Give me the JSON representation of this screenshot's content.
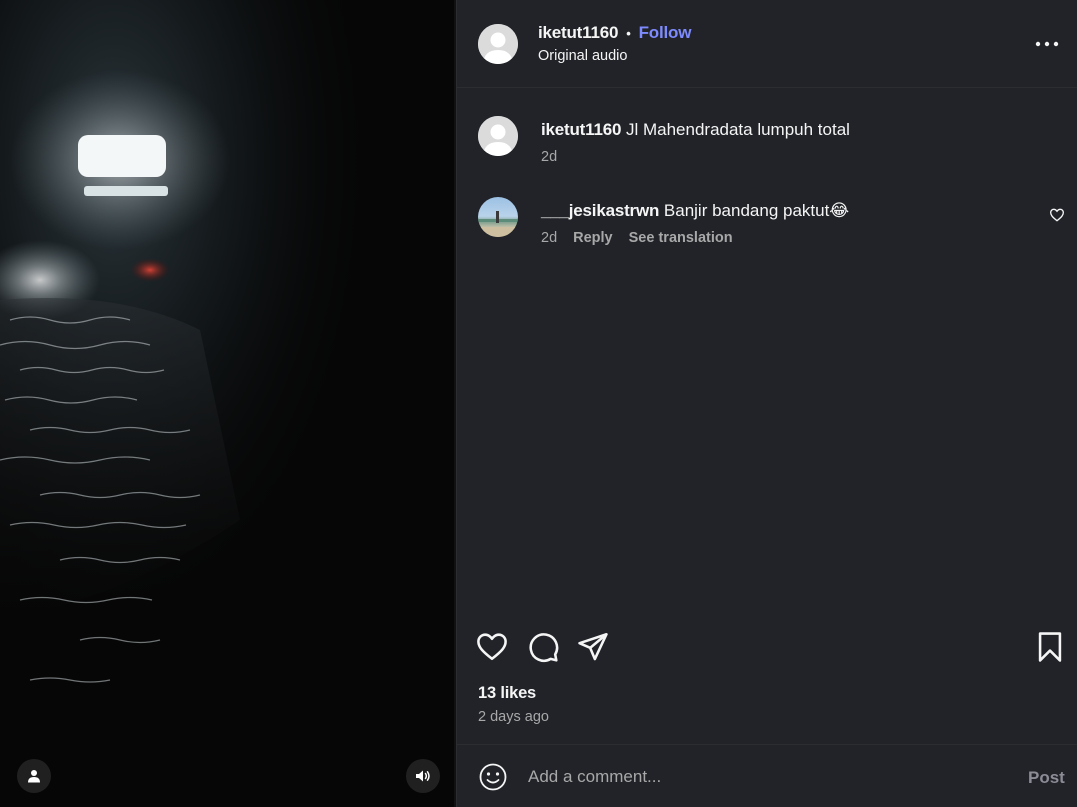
{
  "post": {
    "username": "iketut1160",
    "follow_label": "Follow",
    "dot": "•",
    "audio_label": "Original audio"
  },
  "comments": [
    {
      "username": "iketut1160",
      "text": "Jl Mahendradata lumpuh total",
      "time": "2d"
    },
    {
      "username": "___jesikastrwn",
      "text": "Banjir bandang paktut😂",
      "time": "2d",
      "reply_label": "Reply",
      "translate_label": "See translation"
    }
  ],
  "stats": {
    "likes": "13 likes",
    "time_ago": "2 days ago"
  },
  "composer": {
    "placeholder": "Add a comment...",
    "post_label": "Post"
  },
  "icons": {
    "more": "more-horizontal-icon",
    "like": "heart-outline-icon",
    "comment": "comment-bubble-icon",
    "share": "paper-plane-icon",
    "save": "bookmark-outline-icon",
    "emoji": "emoji-smile-icon",
    "tag": "person-icon",
    "mute": "speaker-icon"
  },
  "colors": {
    "panel_bg": "#212328",
    "follow": "#7e8bff",
    "secondary_text": "#a8a8a8"
  }
}
